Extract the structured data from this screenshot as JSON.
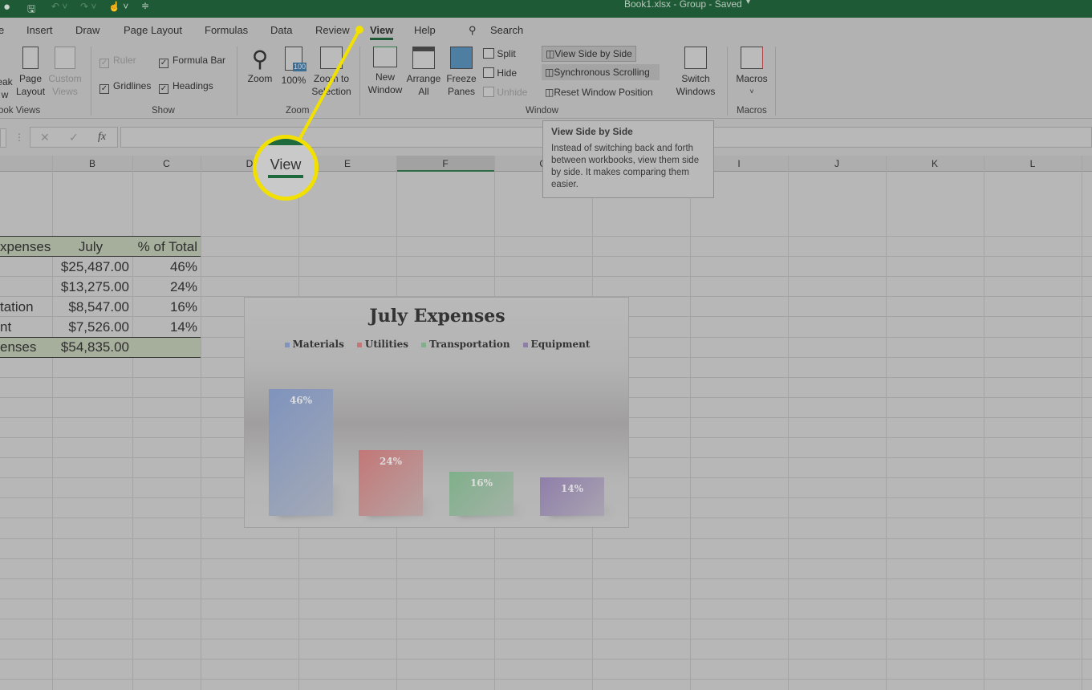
{
  "titlebar": {
    "doc_title": "Book1.xlsx  -  Group  -  Saved"
  },
  "tabs": [
    {
      "label": "e"
    },
    {
      "label": "Insert"
    },
    {
      "label": "Draw"
    },
    {
      "label": "Page Layout"
    },
    {
      "label": "Formulas"
    },
    {
      "label": "Data"
    },
    {
      "label": "Review"
    },
    {
      "label": "View",
      "active": true
    },
    {
      "label": "Help"
    }
  ],
  "search": {
    "label": "Search"
  },
  "ribbon": {
    "workbook_views": {
      "group": "ook Views",
      "page_break": "eak\nw",
      "page_layout": "Page\nLayout",
      "custom_views": "Custom\nViews"
    },
    "show": {
      "group": "Show",
      "ruler": "Ruler",
      "formula_bar": "Formula Bar",
      "gridlines": "Gridlines",
      "headings": "Headings"
    },
    "zoom": {
      "group": "Zoom",
      "zoom": "Zoom",
      "hundred": "100%",
      "zoom_sel": "Zoom to\nSelection",
      "badge": "100"
    },
    "window": {
      "group": "Window",
      "new_window": "New\nWindow",
      "arrange_all": "Arrange\nAll",
      "freeze": "Freeze\nPanes",
      "split": "Split",
      "hide": "Hide",
      "unhide": "Unhide",
      "side_by_side": "View Side by Side",
      "sync_scroll": "Synchronous Scrolling",
      "reset_pos": "Reset Window Position",
      "switch": "Switch\nWindows"
    },
    "macros": {
      "group": "Macros",
      "macros": "Macros"
    }
  },
  "formula_bar": {
    "cancel": "✕",
    "enter": "✓",
    "fx": "fx",
    "value": ""
  },
  "columns": [
    "B",
    "C",
    "D",
    "E",
    "F",
    "G",
    "H",
    "I",
    "J",
    "K",
    "L"
  ],
  "table": {
    "header": [
      "xpenses",
      "July",
      "% of Total"
    ],
    "rows": [
      [
        "",
        "$25,487.00",
        "46%"
      ],
      [
        "",
        "$13,275.00",
        "24%"
      ],
      [
        "tation",
        "$8,547.00",
        "16%"
      ],
      [
        "nt",
        "$7,526.00",
        "14%"
      ]
    ],
    "total": [
      "enses",
      "$54,835.00",
      ""
    ]
  },
  "chart_data": {
    "type": "bar",
    "title": "July Expenses",
    "categories": [
      "Materials",
      "Utilities",
      "Transportation",
      "Equipment"
    ],
    "values": [
      46,
      24,
      16,
      14
    ],
    "data_labels": [
      "46%",
      "24%",
      "16%",
      "14%"
    ],
    "colors": [
      "#7f93bd",
      "#c37777",
      "#7fb08a",
      "#8f7eaa"
    ],
    "legend": "top",
    "grid": false
  },
  "tooltip": {
    "title": "View Side by Side",
    "body": "Instead of switching back and forth between workbooks, view them side by side. It makes comparing them easier."
  },
  "callout": {
    "label": "View",
    "color": "#f1e000"
  }
}
